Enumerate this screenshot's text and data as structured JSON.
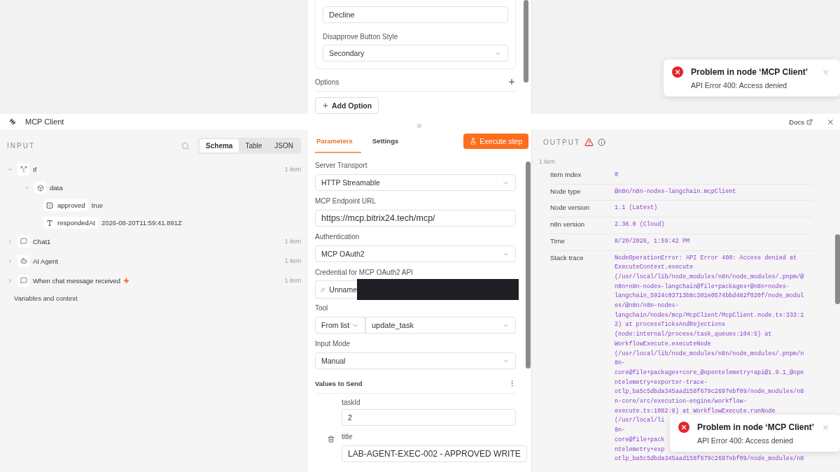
{
  "top_panel": {
    "decline_field": {
      "value": "Decline"
    },
    "style_field": {
      "label": "Disapprove Button Style",
      "value": "Secondary"
    },
    "options_label": "Options",
    "add_option": "Add Option"
  },
  "top_toast": {
    "title": "Problem in node ‘MCP Client’",
    "message": "API Error 400: Access denied"
  },
  "node": {
    "title": "MCP Client",
    "docs": "Docs"
  },
  "input": {
    "title": "INPUT",
    "view_tabs": [
      {
        "label": "Schema",
        "selected": true
      },
      {
        "label": "Table",
        "selected": false
      },
      {
        "label": "JSON",
        "selected": false
      }
    ],
    "tree": [
      {
        "kind": "branch",
        "name": "If",
        "count": "1 item",
        "expanded": true,
        "children": [
          {
            "kind": "object",
            "name": "data",
            "expanded": true,
            "children": [
              {
                "kind": "boolean",
                "name": "approved",
                "value": "true"
              },
              {
                "kind": "string",
                "name": "respondedAt",
                "value": "2026-08-20T11:59:41.891Z"
              }
            ]
          }
        ]
      },
      {
        "kind": "chat",
        "name": "Chat1",
        "count": "1 item",
        "expanded": false
      },
      {
        "kind": "agent",
        "name": "AI Agent",
        "count": "1 item",
        "expanded": false
      },
      {
        "kind": "trigger",
        "name": "When chat message received",
        "count": "1 item",
        "expanded": false
      }
    ],
    "footer": "Variables and context"
  },
  "parameters": {
    "tabs": [
      {
        "label": "Parameters",
        "selected": true
      },
      {
        "label": "Settings",
        "selected": false
      }
    ],
    "execute": "Execute step",
    "fields": [
      {
        "kind": "select",
        "label": "Server Transport",
        "value": "HTTP Streamable"
      },
      {
        "kind": "input",
        "label": "MCP Endpoint URL",
        "value": "https://mcp.bitrix24.tech/mcp/"
      },
      {
        "kind": "select",
        "label": "Authentication",
        "value": "MCP OAuth2"
      },
      {
        "kind": "credential",
        "label": "Credential for MCP OAuth2 API",
        "value": "Unname"
      },
      {
        "kind": "tool",
        "label": "Tool",
        "mode": "From list",
        "value": "update_task"
      },
      {
        "kind": "select",
        "label": "Input Mode",
        "value": "Manual"
      }
    ],
    "values_to_send": {
      "title": "Values to Send",
      "items": [
        {
          "name": "taskId",
          "value": "2",
          "deletable": false
        },
        {
          "name": "title",
          "value": "LAB-AGENT-EXEC-002 - APPROVED WRITE",
          "deletable": true
        }
      ]
    }
  },
  "output": {
    "title": "OUTPUT",
    "count": "1 item",
    "details": [
      {
        "label": "Item Index",
        "value": "0"
      },
      {
        "label": "Node type",
        "value": "@n8n/n8n-nodes-langchain.mcpClient"
      },
      {
        "label": "Node version",
        "value": "1.1 (Latest)"
      },
      {
        "label": "n8n version",
        "value": "2.36.0 (Cloud)"
      },
      {
        "label": "Time",
        "value": "8/20/2026, 1:59:42 PM"
      }
    ],
    "stack_trace": {
      "label": "Stack trace",
      "lines": [
        "NodeOperationError: API Error 400: Access denied at",
        "ExecuteContext.execute",
        "(/usr/local/lib/node_modules/n8n/node_modules/.pnpm/@",
        "n8n+n8n-nodes-langchain@file+packages+@n8n+nodes-",
        "langchain_5924c03713b8c301e0574bbd482f020f/node_modul",
        "es/@n8n/n8n-nodes-",
        "langchain/nodes/mcp/McpClient/McpClient.node.ts:333:1",
        "2) at processTicksAndRejections",
        "(node:internal/process/task_queues:104:5) at",
        "WorkflowExecute.executeNode",
        "(/usr/local/lib/node_modules/n8n/node_modules/.pnpm/n",
        "8n-",
        "core@file+packages+core_@opentelemetry+api@1.9.1_@ope",
        "ntelemetry+exporter-trace-",
        "otlp_ba5c5dbda345aad158f679c2697ebf09/node_modules/n8",
        "n-core/src/execution-engine/workflow-",
        "execute.ts:1082:8) at WorkflowExecute.runNode",
        "(/usr/local/li",
        "8n-",
        "core@file+pack",
        "ntelemetry+exp",
        "otlp_ba5c5dbda345aad158f679c2697ebf09/node_modules/n8"
      ]
    },
    "toast": {
      "title": "Problem in node ‘MCP Client’",
      "message": "API Error 400: Access denied"
    }
  }
}
